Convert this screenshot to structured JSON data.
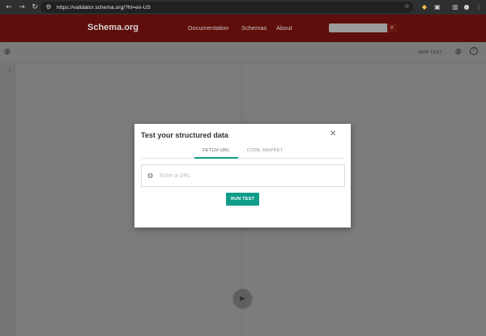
{
  "browser": {
    "url": "https://validator.schema.org/?hl=en-US",
    "icons": [
      "back-icon",
      "forward-icon",
      "reload-icon",
      "site-info-icon",
      "star-icon",
      "tag-extension-icon",
      "extensions-icon",
      "sidebar-icon",
      "profile-icon",
      "menu-icon"
    ]
  },
  "site": {
    "logo": "Schema.org",
    "nav": [
      "Documentation",
      "Schemas",
      "About"
    ],
    "search": {
      "placeholder": ""
    }
  },
  "toolbar": {
    "new_test": "NEW TEST"
  },
  "editor": {
    "line_number": "1"
  },
  "modal": {
    "title": "Test your structured data",
    "tabs": [
      {
        "label": "FETCH URL",
        "active": true
      },
      {
        "label": "CODE SNIPPET",
        "active": false
      }
    ],
    "url_input": {
      "placeholder": "Enter a URL",
      "value": ""
    },
    "run_button": "RUN TEST"
  },
  "colors": {
    "header_bg": "#5e0e0b",
    "accent": "#109d8a",
    "overlay": "#7c7c7c"
  }
}
